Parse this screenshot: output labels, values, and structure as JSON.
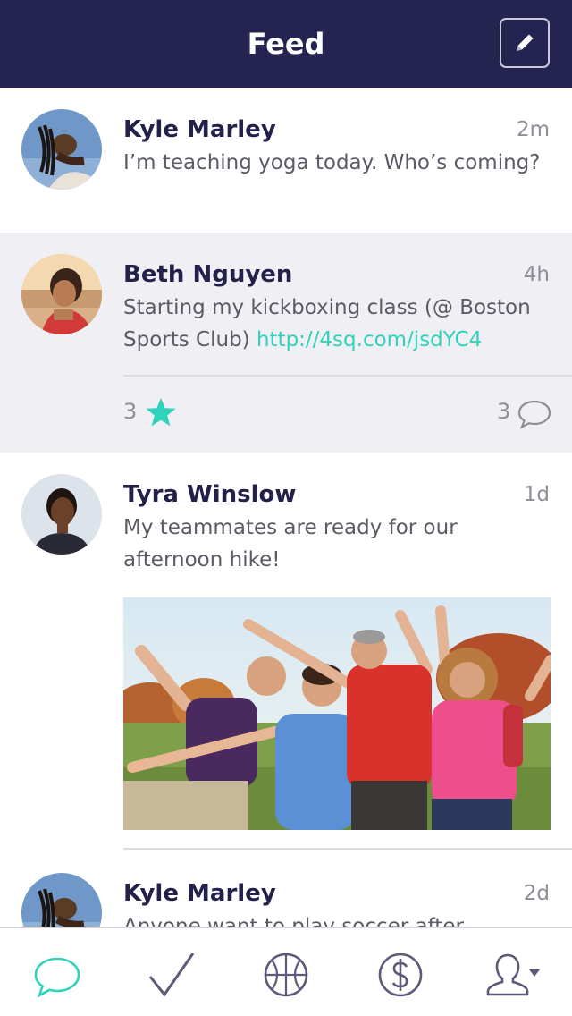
{
  "header": {
    "title": "Feed",
    "compose_icon": "pencil-icon"
  },
  "posts": [
    {
      "name": "Kyle Marley",
      "time": "2m",
      "text": "I’m teaching yoga today. Who’s coming?"
    },
    {
      "name": "Beth Nguyen",
      "time": "4h",
      "text": "Starting my kickboxing class (@ Boston Sports Club) ",
      "link": "http://4sq.com/jsdYC4",
      "stars": "3",
      "comments": "3"
    },
    {
      "name": "Tyra Winslow",
      "time": "1d",
      "text": "My teammates are ready for our afternoon hike!",
      "photo": "group-hike-photo"
    },
    {
      "name": "Kyle Marley",
      "time": "2d",
      "text": "Anyone want to play soccer after"
    }
  ],
  "tabbar": {
    "tabs": [
      {
        "icon": "chat-bubble-icon",
        "active": true
      },
      {
        "icon": "checkmark-icon",
        "active": false
      },
      {
        "icon": "basketball-icon",
        "active": false
      },
      {
        "icon": "dollar-icon",
        "active": false
      },
      {
        "icon": "profile-icon",
        "active": false
      }
    ]
  },
  "colors": {
    "header_bg": "#252450",
    "accent": "#2fd3bc",
    "text_dark": "#23214a",
    "highlight_bg": "#f0f0f4"
  }
}
